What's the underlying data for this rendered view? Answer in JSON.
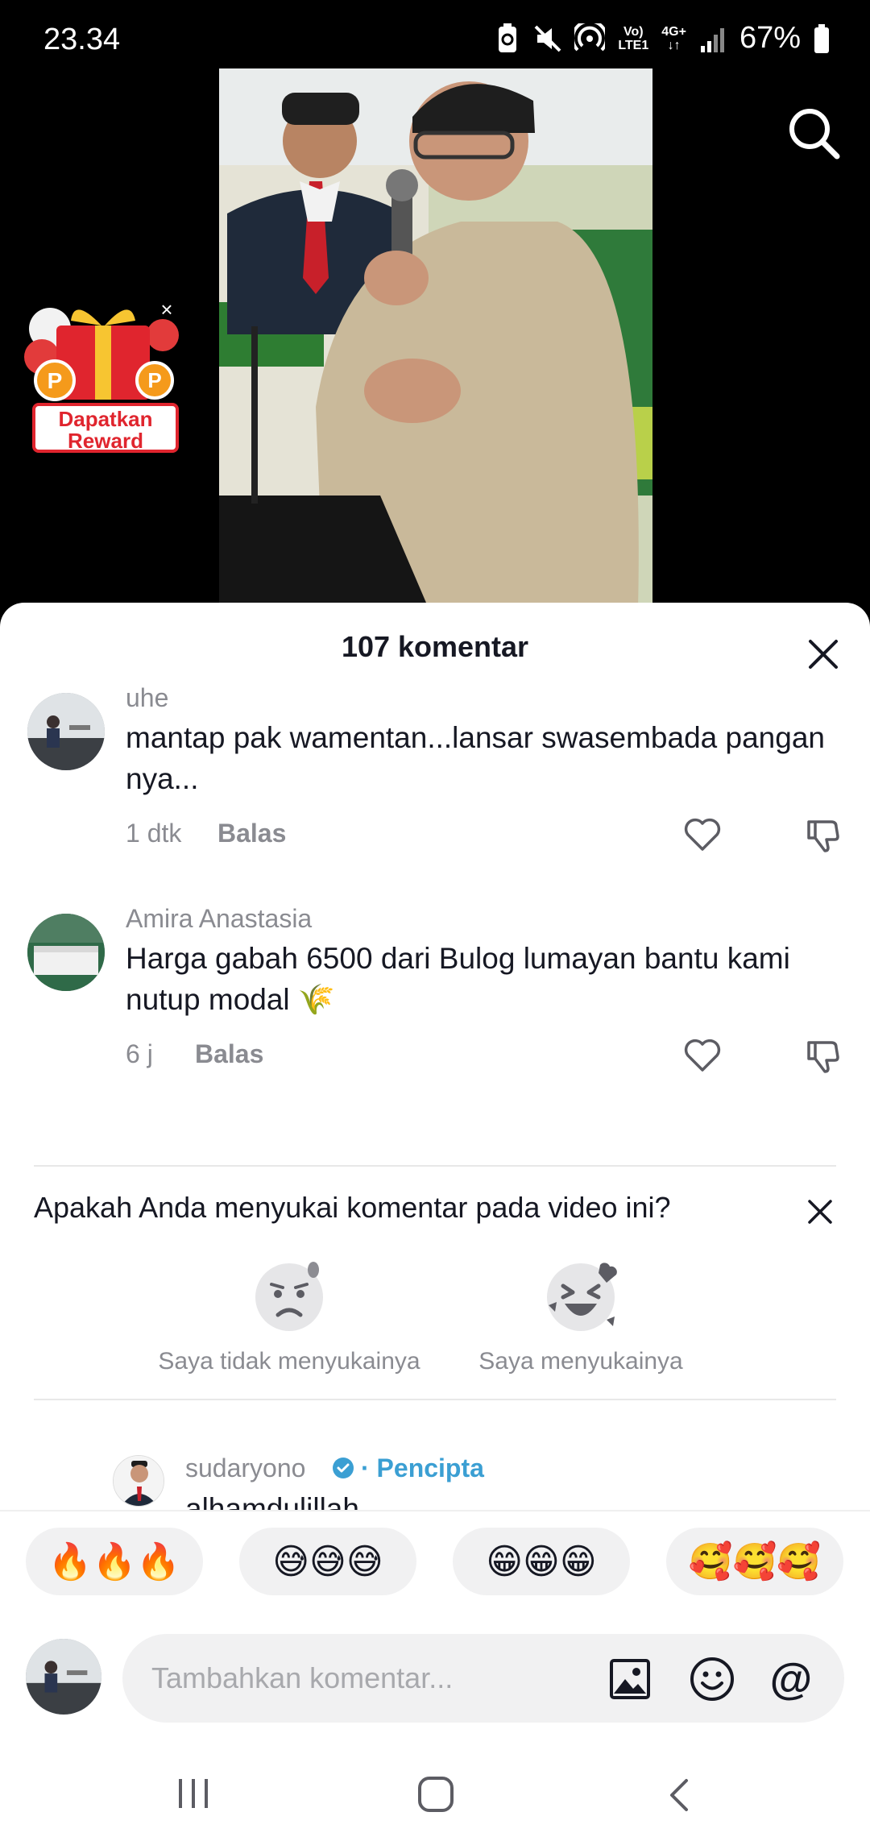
{
  "status_bar": {
    "time": "23.34",
    "network_top": "Vo)",
    "network_bottom": "LTE1",
    "signal_label": "4G+",
    "battery": "67%"
  },
  "reward": {
    "label": "Dapatkan Reward",
    "close": "×"
  },
  "sheet": {
    "title": "107 komentar"
  },
  "comments": [
    {
      "user": "uhe",
      "text": "mantap pak wamentan...lansar swasembada pangan nya...",
      "time": "1 dtk",
      "reply": "Balas"
    },
    {
      "user": "Amira Anastasia",
      "text": "Harga gabah 6500 dari Bulog lumayan bantu kami nutup modal 🌾",
      "time": "6 j",
      "reply": "Balas"
    }
  ],
  "survey": {
    "question": "Apakah Anda menyukai komentar pada video ini?",
    "dislike_label": "Saya tidak menyukainya",
    "like_label": "Saya menyukainya"
  },
  "creator_reply": {
    "name": "sudaryono",
    "tag": "· Pencipta",
    "text": "alhamdulillah"
  },
  "emoji_bar": [
    "🔥🔥🔥",
    "😅😅😅",
    "😁😁😁",
    "🥰🥰🥰"
  ],
  "input": {
    "placeholder": "Tambahkan komentar..."
  },
  "colors": {
    "accent_blue": "#3b9fd3",
    "reward_red": "#e0252e",
    "text_primary": "#161823",
    "text_secondary": "#8a8b91"
  }
}
